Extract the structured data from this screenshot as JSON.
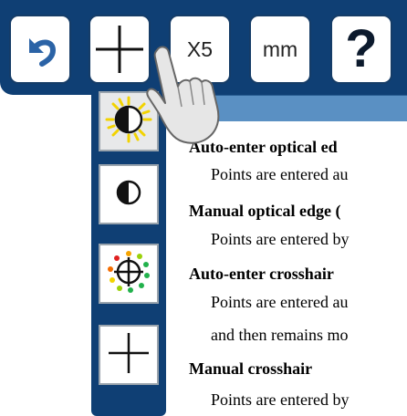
{
  "toolbar": {
    "buttons": [
      {
        "name": "undo",
        "icon": "undo-icon"
      },
      {
        "name": "edge-crosshair-tool",
        "icon": "crosshair-icon"
      },
      {
        "name": "zoom",
        "label": "X5"
      },
      {
        "name": "units",
        "label": "mm"
      },
      {
        "name": "help",
        "label": "?"
      }
    ],
    "accent_color": "#0f3f74",
    "undo_icon_color": "#2b63a6"
  },
  "dropdown": {
    "items": [
      {
        "name": "auto-enter-optical-edge",
        "icon": "auto-optical-edge-icon"
      },
      {
        "name": "manual-optical-edge",
        "icon": "manual-optical-edge-icon"
      },
      {
        "name": "auto-enter-crosshair",
        "icon": "auto-crosshair-icon"
      },
      {
        "name": "manual-crosshair",
        "icon": "manual-crosshair-icon"
      }
    ]
  },
  "document": {
    "entries": [
      {
        "title": "Auto-enter optical ed",
        "body": [
          "Points are entered au"
        ]
      },
      {
        "title": "Manual optical edge (",
        "body": [
          "Points are entered by"
        ]
      },
      {
        "title": "Auto-enter crosshair",
        "body": [
          "Points are entered au",
          "and then remains mo"
        ]
      },
      {
        "title": "Manual crosshair",
        "body": [
          "Points are entered by"
        ]
      }
    ]
  },
  "pointer": {
    "icon": "hand-pointer-icon"
  }
}
